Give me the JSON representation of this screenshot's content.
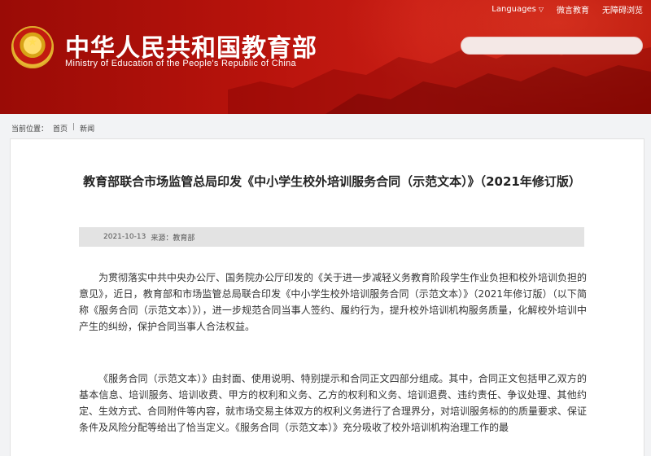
{
  "header": {
    "top_links": {
      "languages": "Languages",
      "link1": "微言教育",
      "link2": "无障碍浏览"
    },
    "site_title": "中华人民共和国教育部",
    "site_subtitle": "Ministry of Education of the People's Republic of China",
    "search": {
      "placeholder": ""
    }
  },
  "breadcrumb": {
    "label": "当前位置：",
    "home": "首页",
    "section": "新闻",
    "separator": "|"
  },
  "article": {
    "title": "教育部联合市场监管总局印发《中小学生校外培训服务合同（示范文本）》（2021年修订版）",
    "date": "2021-10-13",
    "source_label": "来源：",
    "source": "教育部",
    "paragraphs": [
      "为贯彻落实中共中央办公厅、国务院办公厅印发的《关于进一步减轻义务教育阶段学生作业负担和校外培训负担的意见》，近日，教育部和市场监管总局联合印发《中小学生校外培训服务合同（示范文本）》（2021年修订版）（以下简称《服务合同（示范文本）》），进一步规范合同当事人签约、履约行为，提升校外培训机构服务质量，化解校外培训中产生的纠纷，保护合同当事人合法权益。",
      "《服务合同（示范文本）》由封面、使用说明、特别提示和合同正文四部分组成。其中，合同正文包括甲乙双方的基本信息、培训服务、培训收费、甲方的权利和义务、乙方的权利和义务、培训退费、违约责任、争议处理、其他约定、生效方式、合同附件等内容，就市场交易主体双方的权利义务进行了合理界分，对培训服务标的的质量要求、保证条件及风险分配等给出了恰当定义。《服务合同（示范文本）》充分吸收了校外培训机构治理工作的最"
    ]
  },
  "colors": {
    "header_red": "#b8130c",
    "meta_bar": "#e3e3e3",
    "page_bg": "#f2f3f5"
  }
}
